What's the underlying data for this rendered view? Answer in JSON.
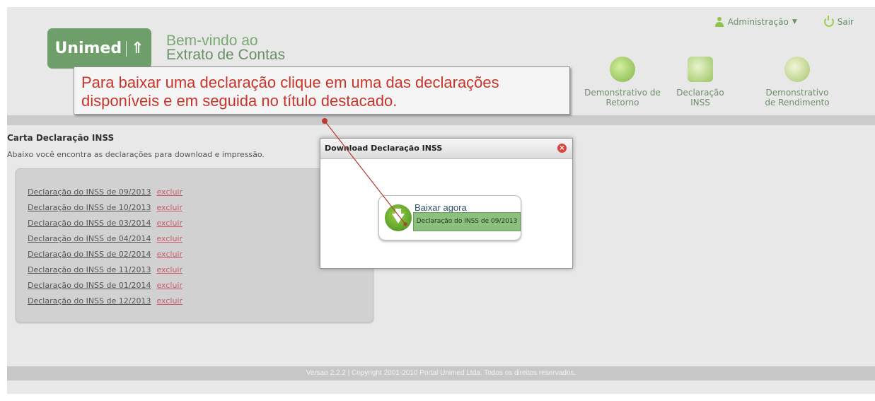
{
  "header": {
    "logo_text": "Unimed",
    "welcome_line1": "Bem-vindo ao",
    "welcome_line2": "Extrato de Contas",
    "admin_label": "Administração",
    "logout_label": "Sair"
  },
  "nav": {
    "items": [
      {
        "label": "Demonstrativo de Retorno",
        "icon": "refresh-arrows-icon"
      },
      {
        "label": "Declaração INSS",
        "icon": "notebook-icon"
      },
      {
        "label": "Demonstrativo de Rendimento",
        "icon": "coins-chart-icon"
      }
    ]
  },
  "callout": {
    "text": "Para baixar uma declaração clique em uma das declarações disponíveis e em seguida no título destacado."
  },
  "section": {
    "title": "Carta Declaração INSS",
    "subtitle": "Abaixo você encontra as declarações para download e impressão."
  },
  "declarations": {
    "delete_label": "excluir",
    "items": [
      "Declaração do INSS de 09/2013",
      "Declaração do INSS de 10/2013",
      "Declaração do INSS de 03/2014",
      "Declaração do INSS de 04/2014",
      "Declaração do INSS de 02/2014",
      "Declaração do INSS de 11/2013",
      "Declaração do INSS de 01/2014",
      "Declaração do INSS de 12/2013"
    ]
  },
  "modal": {
    "title": "Download Declaração INSS",
    "download_label": "Baixar agora",
    "file_label": "Declaração do INSS de 09/2013"
  },
  "footer": {
    "text": "Versao 2.2.2 | Copyright 2001-2010 Portal Unimed Ltda. Todos os direitos reservados."
  }
}
